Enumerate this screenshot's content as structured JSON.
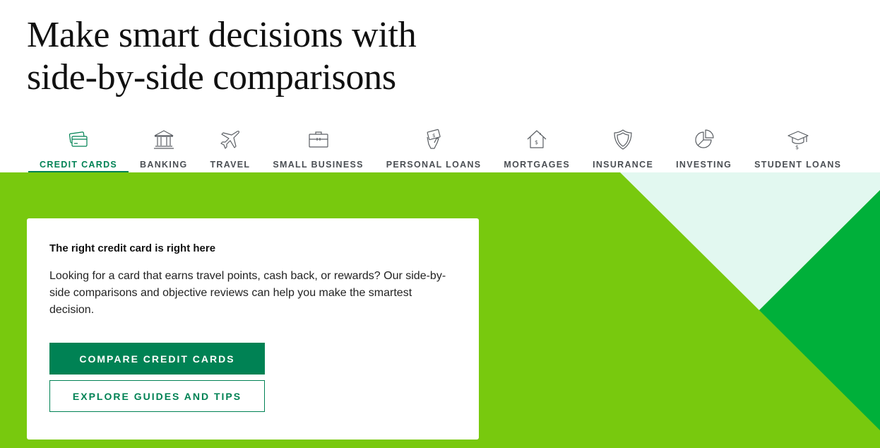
{
  "headline": {
    "line1": "Make smart decisions with",
    "line2": "side-by-side comparisons"
  },
  "tabs": [
    {
      "label": "CREDIT CARDS",
      "icon": "credit-card-icon",
      "active": true
    },
    {
      "label": "BANKING",
      "icon": "bank-icon",
      "active": false
    },
    {
      "label": "TRAVEL",
      "icon": "airplane-icon",
      "active": false
    },
    {
      "label": "SMALL BUSINESS",
      "icon": "briefcase-icon",
      "active": false
    },
    {
      "label": "PERSONAL LOANS",
      "icon": "money-hand-icon",
      "active": false
    },
    {
      "label": "MORTGAGES",
      "icon": "house-icon",
      "active": false
    },
    {
      "label": "INSURANCE",
      "icon": "shield-icon",
      "active": false
    },
    {
      "label": "INVESTING",
      "icon": "pie-chart-icon",
      "active": false
    },
    {
      "label": "STUDENT LOANS",
      "icon": "graduation-cap-icon",
      "active": false
    }
  ],
  "card": {
    "title": "The right credit card is right here",
    "body": "Looking for a card that earns travel points, cash back, or rewards? Our side-by-side comparisons and objective reviews can help you make the smartest decision.",
    "primary_button": "COMPARE CREDIT CARDS",
    "secondary_button": "EXPLORE GUIDES AND TIPS"
  },
  "colors": {
    "accent": "#008254",
    "hero_green": "#78c90e",
    "dark_green": "#00b03a",
    "mint": "#e2f8f0",
    "tab_text": "#4b4f54"
  }
}
